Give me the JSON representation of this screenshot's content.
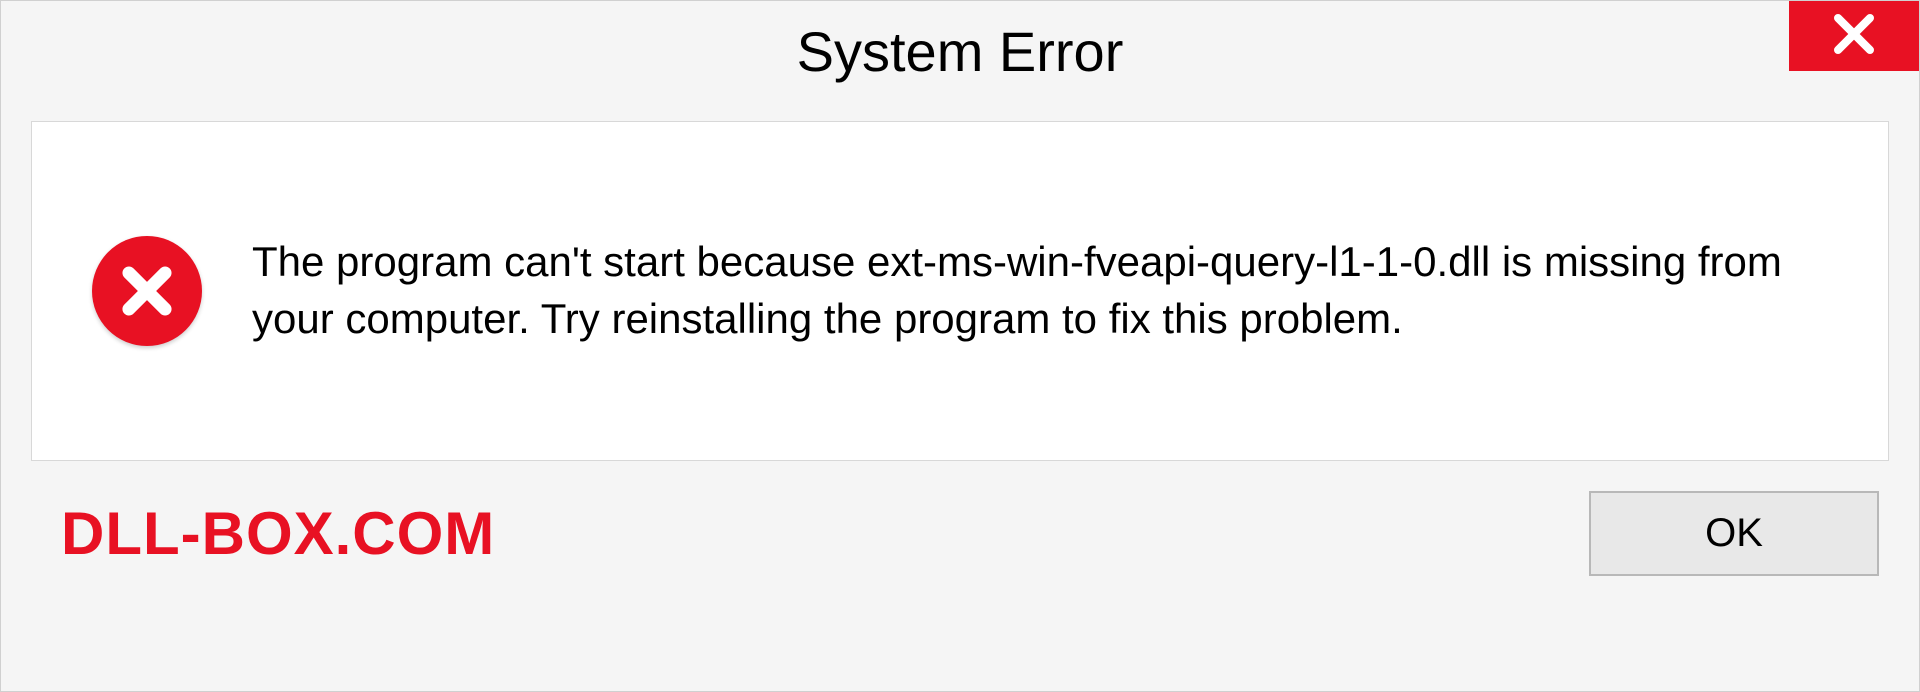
{
  "dialog": {
    "title": "System Error",
    "message": "The program can't start because ext-ms-win-fveapi-query-l1-1-0.dll is missing from your computer. Try reinstalling the program to fix this problem.",
    "ok_label": "OK"
  },
  "watermark": "DLL-BOX.COM"
}
